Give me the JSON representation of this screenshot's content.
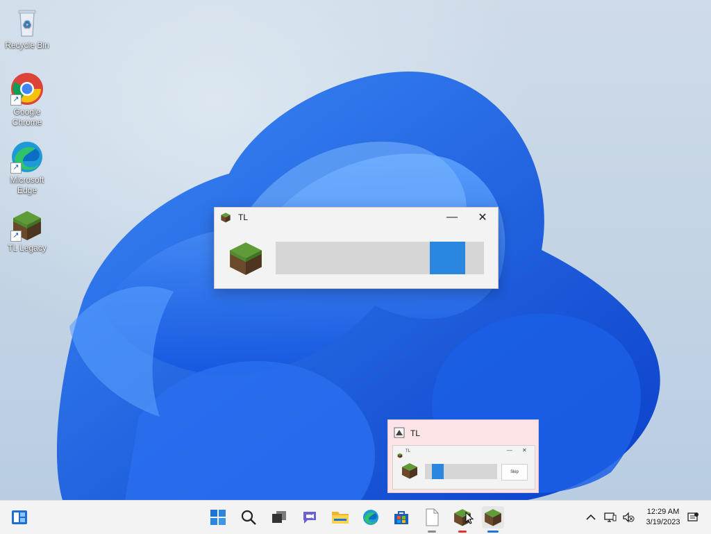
{
  "desktop": {
    "icons": [
      {
        "label": "Recycle Bin",
        "icon": "recycle-bin-icon"
      },
      {
        "label": "Google Chrome",
        "icon": "chrome-icon"
      },
      {
        "label": "Microsoft Edge",
        "icon": "edge-icon"
      },
      {
        "label": "TL Legacy",
        "icon": "grass-block-icon"
      }
    ]
  },
  "main_window": {
    "title": "TL",
    "minimize_symbol": "—",
    "close_symbol": "✕",
    "progress_segment": {
      "start_fraction": 0.74,
      "end_fraction": 0.91
    },
    "accent_color": "#2b86e0"
  },
  "taskbar_preview": {
    "title": "TL",
    "thumbnail": {
      "title": "TL",
      "skip_label": "Skip",
      "progress_segment": {
        "start_fraction": 0.1,
        "end_fraction": 0.26
      }
    }
  },
  "taskbar": {
    "apps": [
      {
        "name": "start",
        "icon": "windows-start-icon"
      },
      {
        "name": "search",
        "icon": "search-icon"
      },
      {
        "name": "task-view",
        "icon": "task-view-icon"
      },
      {
        "name": "chat",
        "icon": "teams-chat-icon"
      },
      {
        "name": "file-explorer",
        "icon": "folder-icon"
      },
      {
        "name": "edge",
        "icon": "edge-icon"
      },
      {
        "name": "store",
        "icon": "store-icon"
      },
      {
        "name": "document",
        "icon": "document-icon"
      },
      {
        "name": "tl-launcher-1",
        "icon": "grass-block-icon",
        "indicator_color": "#e0352b"
      },
      {
        "name": "tl-launcher-2",
        "icon": "grass-block-icon",
        "indicator_color": "#1a73d9"
      }
    ],
    "tray": {
      "chevron_icon": "chevron-up-icon",
      "network_icon": "network-icon",
      "volume_icon": "volume-muted-icon",
      "notification_icon": "notification-icon"
    },
    "clock": {
      "time": "12:29 AM",
      "date": "3/19/2023"
    }
  }
}
